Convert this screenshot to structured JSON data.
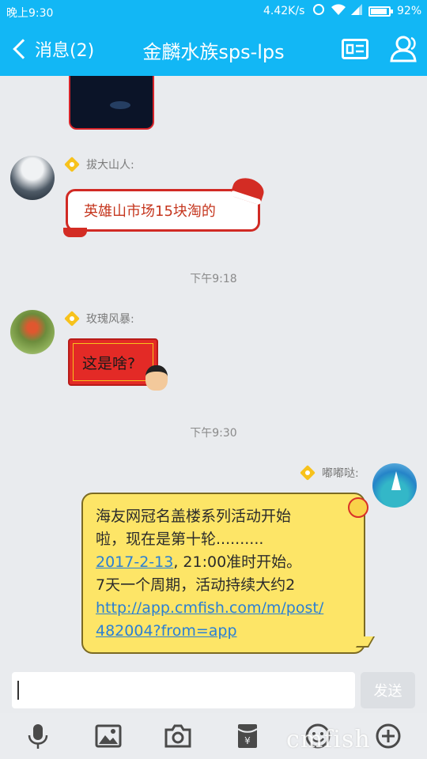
{
  "status_bar": {
    "time": "晚上9:30",
    "speed": "4.42K/s",
    "battery_pct": "92%",
    "battery_level": 0.92
  },
  "header": {
    "back_label": "消息(2)",
    "title": "金麟水族sps-lps",
    "icons": [
      "profile-card-icon",
      "group-members-icon"
    ],
    "accent_color": "#12b7f5"
  },
  "messages": [
    {
      "type": "image",
      "sender": ""
    },
    {
      "type": "text",
      "sender": "拔大山人:",
      "text": "英雄山市场15块淘的"
    },
    {
      "type": "time",
      "text": "下午9:18"
    },
    {
      "type": "text",
      "sender": "玫瑰风暴:",
      "text": "这是啥?"
    },
    {
      "type": "time",
      "text": "下午9:30"
    },
    {
      "type": "text",
      "sender": "嘟嘟哒:",
      "line1": "海友网冠名盖楼系列活动开始",
      "line2": "啦，现在是第十轮..........",
      "date_link": "2017-2-13",
      "line3_rest": ", 21:00准时开始。",
      "line4": "7天一个周期，活动持续大约2",
      "url_line1": "http://app.cmfish.com/m/post/",
      "url_line2": "482004?from=app"
    }
  ],
  "input": {
    "value": "",
    "send_label": "发送"
  },
  "toolbar": {
    "icons": [
      "microphone-icon",
      "image-icon",
      "camera-icon",
      "red-packet-icon",
      "emoji-icon",
      "plus-icon"
    ]
  },
  "watermark": "cmfish"
}
